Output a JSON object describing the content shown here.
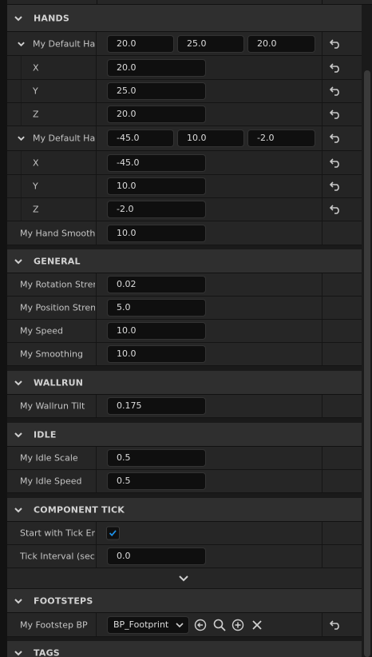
{
  "sections": {
    "hands": "HANDS",
    "general": "GENERAL",
    "wallrun": "WALLRUN",
    "idle": "IDLE",
    "component_tick": "COMPONENT TICK",
    "footsteps": "FOOTSTEPS",
    "tags": "TAGS"
  },
  "hands": {
    "offset1": {
      "label": "My Default Hand Offset",
      "x": "20.0",
      "y": "25.0",
      "z": "20.0",
      "x_label": "X",
      "y_label": "Y",
      "z_label": "Z"
    },
    "offset2": {
      "label": "My Default Hand Rotation",
      "x": "-45.0",
      "y": "10.0",
      "z": "-2.0",
      "x_label": "X",
      "y_label": "Y",
      "z_label": "Z"
    },
    "smoothing": {
      "label": "My Hand Smoothing",
      "value": "10.0"
    }
  },
  "general": {
    "rotation_strength": {
      "label": "My Rotation Strength",
      "value": "0.02"
    },
    "position_strength": {
      "label": "My Position Strength",
      "value": "5.0"
    },
    "speed": {
      "label": "My Speed",
      "value": "10.0"
    },
    "smoothing": {
      "label": "My Smoothing",
      "value": "10.0"
    }
  },
  "wallrun": {
    "tilt": {
      "label": "My Wallrun Tilt",
      "value": "0.175"
    }
  },
  "idle": {
    "scale": {
      "label": "My Idle Scale",
      "value": "0.5"
    },
    "speed": {
      "label": "My Idle Speed",
      "value": "0.5"
    }
  },
  "component_tick": {
    "start_with_tick": {
      "label": "Start with Tick Enabled",
      "checked": true
    },
    "tick_interval": {
      "label": "Tick Interval (secs)",
      "value": "0.0"
    }
  },
  "footsteps": {
    "footstep_bp": {
      "label": "My Footstep BP",
      "value": "BP_Footprint"
    }
  },
  "icons": {
    "reset": "reset-to-default-icon",
    "browse": "use-selected-icon",
    "search": "search-icon",
    "add": "add-icon",
    "clear": "clear-icon"
  },
  "colors": {
    "check": "#1e90e6",
    "section_bg": "#2f2f2f",
    "row_bg": "#262626",
    "field_bg": "#0f0f0f"
  }
}
